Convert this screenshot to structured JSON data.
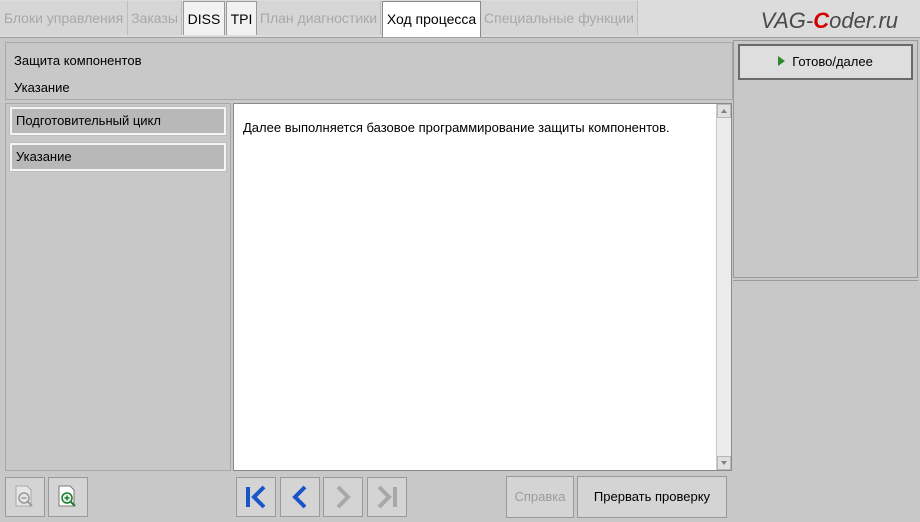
{
  "tabs": [
    {
      "label": "Блоки управления",
      "state": "disabled"
    },
    {
      "label": "Заказы",
      "state": "disabled"
    },
    {
      "label": "DISS",
      "state": "enabled"
    },
    {
      "label": "TPI",
      "state": "enabled"
    },
    {
      "label": "План диагностики",
      "state": "disabled"
    },
    {
      "label": "Ход процесса",
      "state": "selected"
    },
    {
      "label": "Специальные функции",
      "state": "disabled"
    }
  ],
  "watermark": {
    "prefix": "VAG-",
    "accent": "C",
    "suffix": "oder.ru"
  },
  "header": {
    "title": "Защита компонентов",
    "subtitle": "Указание"
  },
  "steps": [
    "Подготовительный цикл",
    "Указание"
  ],
  "content": {
    "text": "Далее выполняется базовое программирование защиты компонентов."
  },
  "actions": {
    "done_label": "Готово/далее",
    "help_label": "Справка",
    "abort_label": "Прервать проверку"
  },
  "icons": {
    "zoom_out": "zoom-out-icon",
    "zoom_in": "zoom-in-icon",
    "first": "skip-first-icon",
    "prev": "chevron-left-icon",
    "next": "chevron-right-icon",
    "last": "skip-last-icon"
  },
  "colors": {
    "accent_blue": "#1a55c8",
    "done_arrow": "#2c8a2c",
    "logo_red": "#d40000"
  }
}
